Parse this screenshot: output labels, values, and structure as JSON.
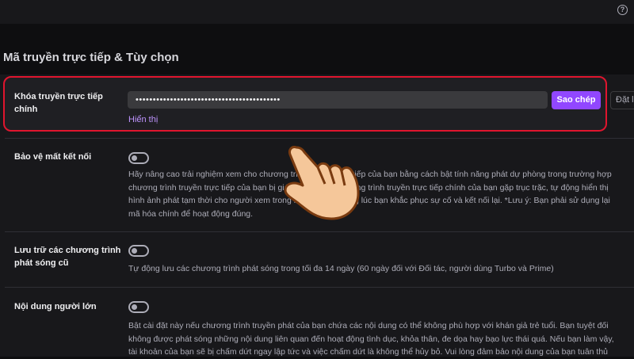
{
  "header": {
    "help_icon": "?"
  },
  "section": {
    "title": "Mã truyền trực tiếp & Tùy chọn"
  },
  "stream_key": {
    "label_line1": "Khóa truyền trực tiếp",
    "label_line2": "chính",
    "masked_value": "••••••••••••••••••••••••••••••••••••••••••",
    "copy_label": "Sao chép",
    "reset_label": "Đặt lại",
    "show_link": "Hiển thị"
  },
  "disconnect_protection": {
    "label": "Bảo vệ mất kết nối",
    "enabled": false,
    "desc_lines": [
      "Hãy nâng cao trải nghiệm xem cho chương trình truyền trực tiếp của bạn bằng cách bật tính năng phát dự phòng trong trường hợp",
      "chương trình truyền trực tiếp của bạn bị gián đoạn. Nếu chương trình truyền trực tiếp chính của bạn gặp trục trặc, tự động hiển thị",
      "hình ảnh phát tạm thời cho người xem trong khi chờ đợi, trong lúc bạn khắc phục sự cố và kết nối lại. *Lưu ý: Bạn phải sử dụng lại",
      "mã hóa chính để hoạt động đúng."
    ]
  },
  "archive": {
    "label_line1": "Lưu trữ các chương trình",
    "label_line2": "phát sóng cũ",
    "enabled": false,
    "desc": "Tự động lưu các chương trình phát sóng trong tối đa 14 ngày (60 ngày đối với Đối tác, người dùng Turbo và Prime)"
  },
  "mature": {
    "label": "Nội dung người lớn",
    "enabled": false,
    "desc_lines": [
      "Bật cài đặt này nếu chương trình truyền phát của bạn chứa các nội dung có thể không phù hợp với khán giả trẻ tuổi. Bạn tuyệt đối",
      "không được phát sóng những nội dung liên quan đến hoạt động tình dục, khỏa thân, đe dọa hay bạo lực thái quá. Nếu bạn làm vậy,",
      "tài khoản của bạn sẽ bị chấm dứt ngay lập tức và việc chấm dứt là không thể hủy bỏ. Vui lòng đảm bảo nội dung của bạn tuân thủ"
    ]
  },
  "colors": {
    "accent": "#9147ff",
    "highlight": "#e0152e",
    "link": "#bf94ff"
  }
}
